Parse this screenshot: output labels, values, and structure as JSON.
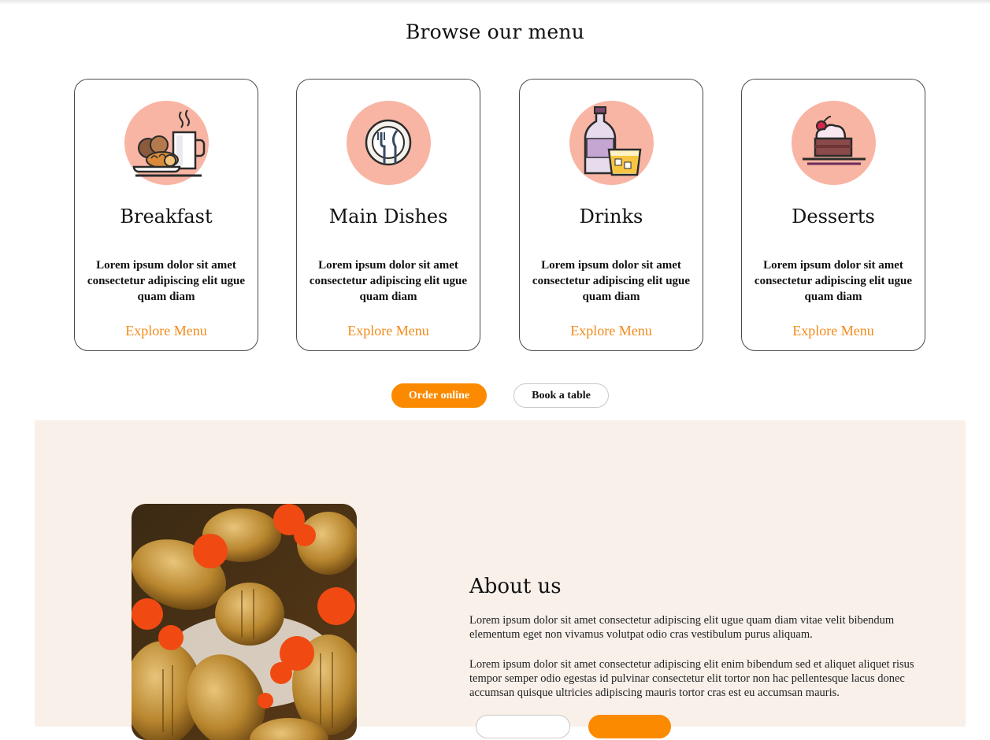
{
  "menu_section": {
    "title": "Browse our menu",
    "cards": [
      {
        "title": "Breakfast",
        "desc": "Lorem ipsum dolor sit amet consectetur adipiscing elit ugue quam diam",
        "link": "Explore Menu",
        "icon": "breakfast-icon"
      },
      {
        "title": "Main Dishes",
        "desc": "Lorem ipsum dolor sit amet consectetur adipiscing elit ugue quam diam",
        "link": "Explore Menu",
        "icon": "plate-fork-knife-icon"
      },
      {
        "title": "Drinks",
        "desc": "Lorem ipsum dolor sit amet consectetur adipiscing elit ugue quam diam",
        "link": "Explore Menu",
        "icon": "drinks-bottle-glass-icon"
      },
      {
        "title": "Desserts",
        "desc": "Lorem ipsum dolor sit amet consectetur adipiscing elit ugue quam diam",
        "link": "Explore Menu",
        "icon": "cake-dessert-icon"
      }
    ],
    "order_button": "Order online",
    "book_button": "Book a table"
  },
  "about_section": {
    "title": "About us",
    "paragraph_1": "Lorem ipsum dolor sit amet consectetur adipiscing elit ugue quam diam vitae velit bibendum elementum eget non vivamus volutpat odio cras vestibulum purus aliquam.",
    "paragraph_2": "Lorem ipsum dolor sit amet consectetur adipiscing elit enim bibendum sed et aliquet aliquet risus tempor semper odio egestas id pulvinar consectetur elit tortor non hac pellentesque lacus donec accumsan quisque ultricies adipiscing mauris tortor cras est eu accumsan mauris.",
    "image": "roasted-potatoes-photo"
  },
  "colors": {
    "accent": "#fb8a00",
    "link": "#f28a1a",
    "icon_circle": "#f8b5a3",
    "about_bg": "#f8f0e9"
  }
}
